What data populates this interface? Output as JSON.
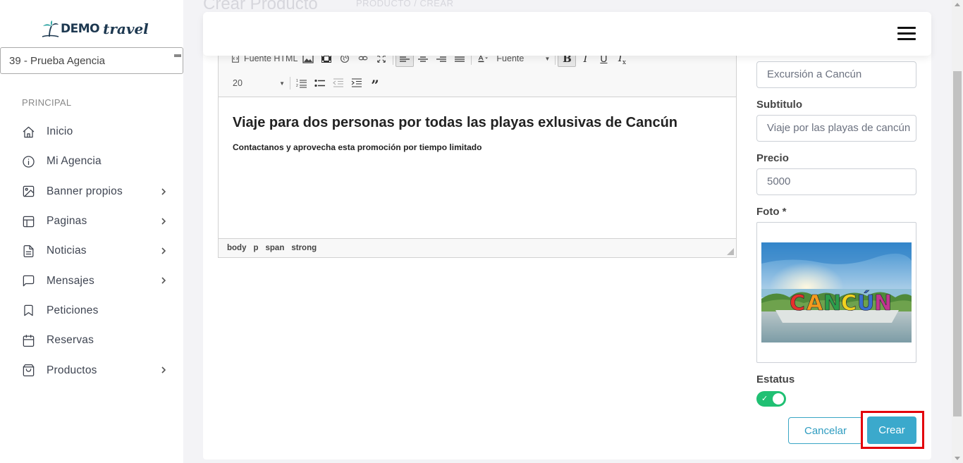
{
  "page": {
    "title": "Crear Producto",
    "breadcrumb": "PRODUCTO / CREAR"
  },
  "logo": {
    "word1": "DEMO",
    "word2": "travel"
  },
  "agency_select": {
    "value": "39 - Prueba Agencia"
  },
  "sidebar": {
    "section": "PRINCIPAL",
    "items": [
      {
        "label": "Inicio",
        "icon": "home-icon",
        "has_submenu": false
      },
      {
        "label": "Mi Agencia",
        "icon": "info-icon",
        "has_submenu": false
      },
      {
        "label": "Banner propios",
        "icon": "image-icon",
        "has_submenu": true
      },
      {
        "label": "Paginas",
        "icon": "layout-icon",
        "has_submenu": true
      },
      {
        "label": "Noticias",
        "icon": "document-icon",
        "has_submenu": true
      },
      {
        "label": "Mensajes",
        "icon": "message-icon",
        "has_submenu": true
      },
      {
        "label": "Peticiones",
        "icon": "bookmark-icon",
        "has_submenu": false
      },
      {
        "label": "Reservas",
        "icon": "calendar-icon",
        "has_submenu": false
      },
      {
        "label": "Productos",
        "icon": "shopping-bag-icon",
        "has_submenu": true
      }
    ]
  },
  "editor": {
    "toolbar": {
      "source_label": "Fuente HTML",
      "font_combo": "Fuente",
      "size_combo": "20"
    },
    "content": {
      "heading": "Viaje para dos personas por todas las playas exlusivas de Cancún",
      "paragraph": "Contactanos y aprovecha esta promoción por tiempo limitado"
    },
    "path": [
      "body",
      "p",
      "span",
      "strong"
    ]
  },
  "form": {
    "title_value": "Excursión a Cancún",
    "subtitle_label": "Subtitulo",
    "subtitle_value": "Viaje por las playas de cancún",
    "price_label": "Precio",
    "price_value": "5000",
    "photo_label": "Foto *",
    "photo_text": "CANCÚN",
    "status_label": "Estatus",
    "status_on": true
  },
  "actions": {
    "cancel": "Cancelar",
    "create": "Crear"
  },
  "colors": {
    "accent": "#3ba9cc",
    "toggle_on": "#20c073",
    "highlight": "#e3000b",
    "brand": "#1d3850"
  }
}
